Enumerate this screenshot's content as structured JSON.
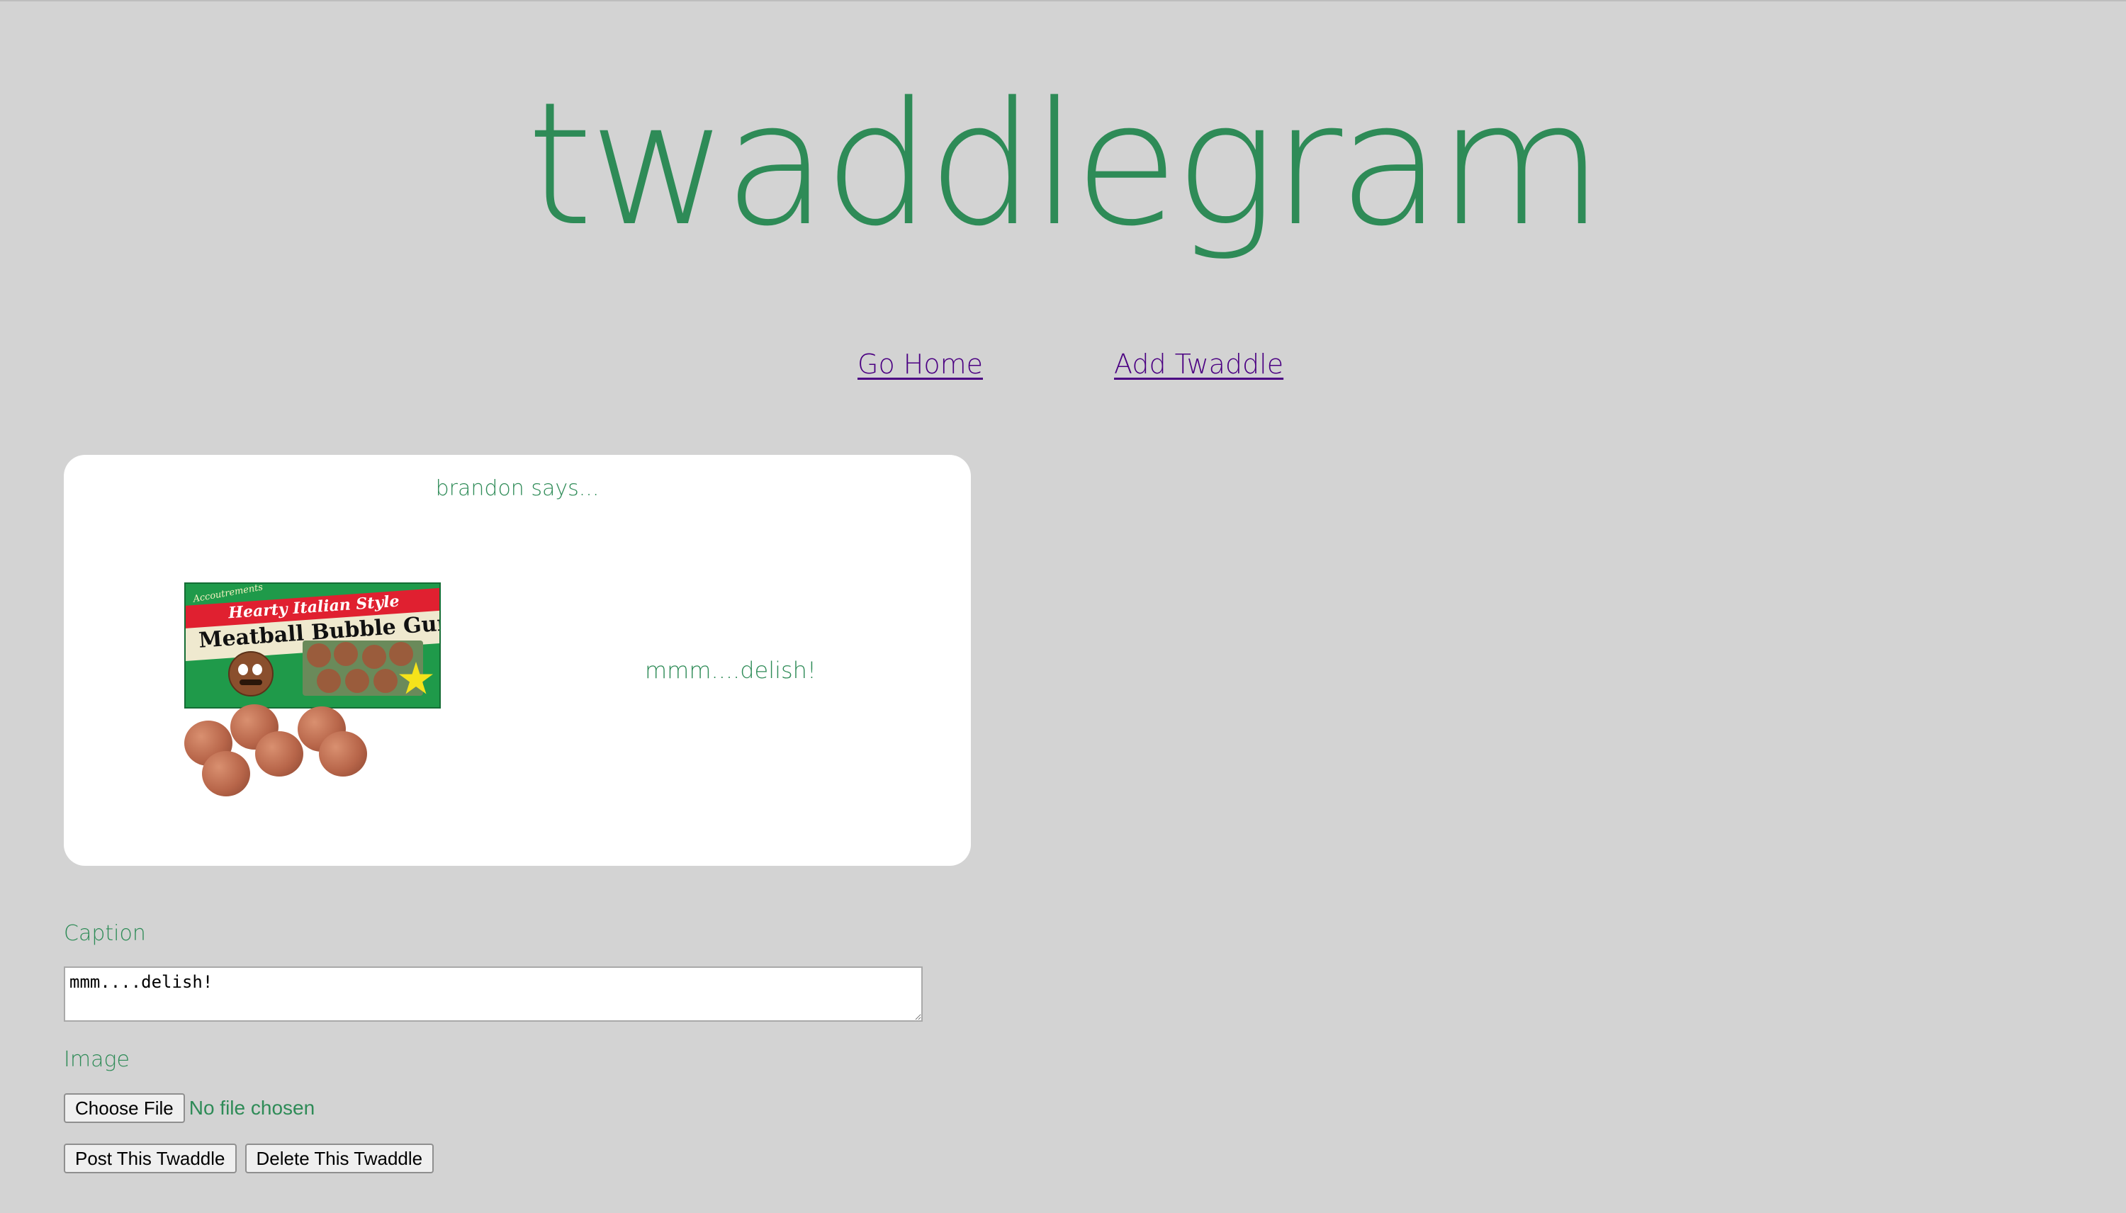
{
  "site": {
    "logo_text": "twaddlegram"
  },
  "nav": {
    "home_label": "Go Home",
    "add_label": "Add Twaddle"
  },
  "post": {
    "author_line": "brandon says...",
    "caption": "mmm....delish!",
    "image": {
      "brand": "Accoutrements",
      "tagline": "Hearty Italian Style",
      "product_name": "Meatball Bubble Gum"
    }
  },
  "form": {
    "caption_label": "Caption",
    "caption_value": "mmm....delish!",
    "image_label": "Image",
    "choose_file_label": "Choose File",
    "file_status": "No file chosen",
    "post_button_label": "Post This Twaddle",
    "delete_button_label": "Delete This Twaddle"
  },
  "colors": {
    "background": "#d3d3d3",
    "accent_green": "#2e8b57",
    "link_purple": "#4b0082",
    "card": "#ffffff"
  }
}
